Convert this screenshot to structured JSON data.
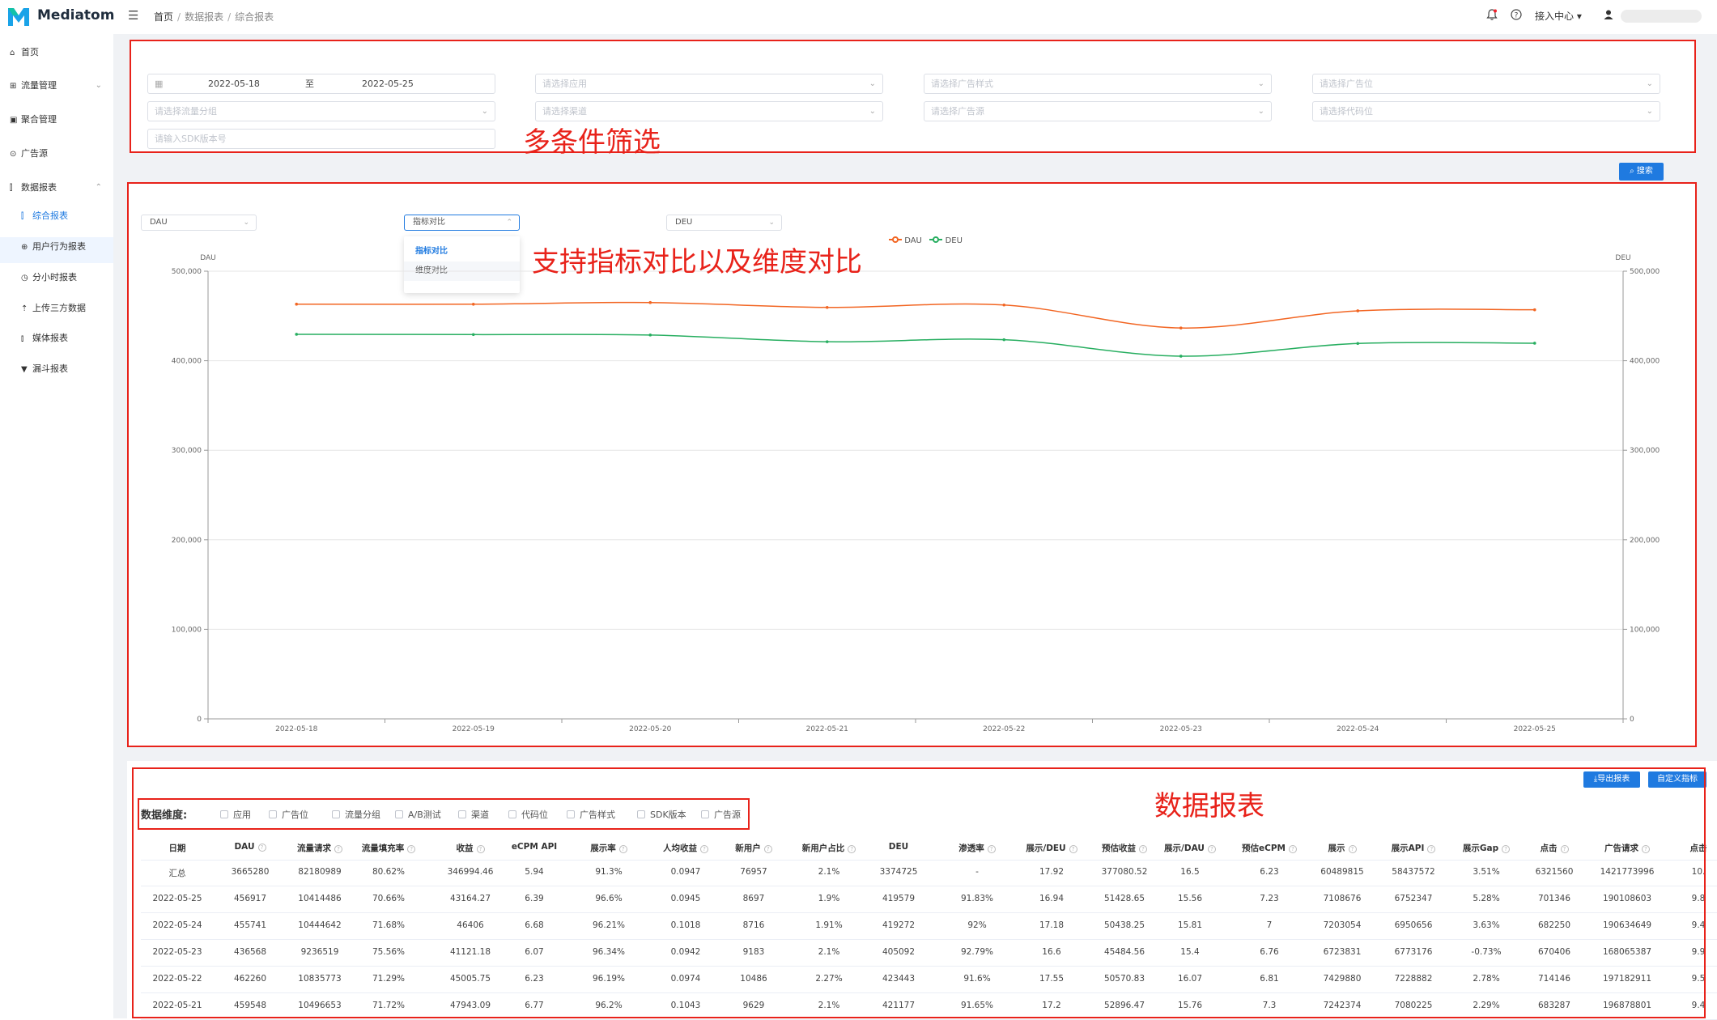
{
  "app": {
    "name": "Mediatom"
  },
  "breadcrumb": {
    "home": "首页",
    "reports": "数据报表",
    "current": "综合报表"
  },
  "topbar": {
    "access_center": "接入中心"
  },
  "sidebar": {
    "home": "首页",
    "traffic": "流量管理",
    "aggregate": "聚合管理",
    "ad_source": "广告源",
    "reports": "数据报表",
    "sub": {
      "overall": "综合报表",
      "user_behavior": "用户行为报表",
      "hourly": "分小时报表",
      "third_party": "上传三方数据",
      "media": "媒体报表",
      "funnel": "漏斗报表"
    }
  },
  "filters": {
    "date_start": "2022-05-18",
    "date_sep": "至",
    "date_end": "2022-05-25",
    "app_placeholder": "请选择应用",
    "ad_style_placeholder": "请选择广告样式",
    "ad_slot_placeholder": "请选择广告位",
    "traffic_group_placeholder": "请选择流量分组",
    "channel_placeholder": "请选择渠道",
    "ad_source_placeholder": "请选择广告源",
    "code_slot_placeholder": "请选择代码位",
    "sdk_placeholder": "请输入SDK版本号",
    "search_button": "搜索"
  },
  "annotations": {
    "filter": "多条件筛选",
    "chart": "支持指标对比以及维度对比",
    "table": "数据报表"
  },
  "chart_controls": {
    "left_metric": "DAU",
    "compare_mode": "指标对比",
    "right_metric": "DEU",
    "options": [
      "指标对比",
      "维度对比"
    ]
  },
  "colors": {
    "dau": "#f26522",
    "deu": "#27ae60",
    "accent": "#1f7ae0",
    "annotation": "#e8221a"
  },
  "chart_data": {
    "type": "line",
    "x": [
      "2022-05-18",
      "2022-05-19",
      "2022-05-20",
      "2022-05-21",
      "2022-05-22",
      "2022-05-23",
      "2022-05-24",
      "2022-05-25"
    ],
    "series": [
      {
        "name": "DAU",
        "axis": "left",
        "values": [
          463200,
          463100,
          465000,
          459548,
          462260,
          436568,
          455741,
          456917
        ]
      },
      {
        "name": "DEU",
        "axis": "right",
        "values": [
          429500,
          429200,
          428700,
          421177,
          423443,
          405092,
          419272,
          419579
        ]
      }
    ],
    "ylabel_left": "DAU",
    "ylabel_right": "DEU",
    "ylim": [
      0,
      500000
    ],
    "yticks": [
      "500,000",
      "400,000",
      "300,000",
      "200,000",
      "100,000",
      "0"
    ],
    "legend": "top-center",
    "grid": true
  },
  "table": {
    "export_button": "导出报表",
    "custom_metrics_button": "自定义指标",
    "dimension_label": "数据维度:",
    "dimensions": [
      "应用",
      "广告位",
      "流量分组",
      "A/B测试",
      "渠道",
      "代码位",
      "广告样式",
      "SDK版本",
      "广告源"
    ],
    "columns": [
      "日期",
      "DAU",
      "流量请求",
      "流量填充率",
      "收益",
      "eCPM API",
      "展示率",
      "人均收益",
      "新用户",
      "新用户占比",
      "DEU",
      "渗透率",
      "展示/DEU",
      "预估收益",
      "展示/DAU",
      "预估eCPM",
      "展示",
      "展示API",
      "展示Gap",
      "点击",
      "广告请求",
      "点击"
    ],
    "rows": [
      [
        "汇总",
        "3665280",
        "82180989",
        "80.62%",
        "346994.46",
        "5.94",
        "91.3%",
        "0.0947",
        "76957",
        "2.1%",
        "3374725",
        "-",
        "17.92",
        "377080.52",
        "16.5",
        "6.23",
        "60489815",
        "58437572",
        "3.51%",
        "6321560",
        "1421773996",
        "10."
      ],
      [
        "2022-05-25",
        "456917",
        "10414486",
        "70.66%",
        "43164.27",
        "6.39",
        "96.6%",
        "0.0945",
        "8697",
        "1.9%",
        "419579",
        "91.83%",
        "16.94",
        "51428.65",
        "15.56",
        "7.23",
        "7108676",
        "6752347",
        "5.28%",
        "701346",
        "190108603",
        "9.8"
      ],
      [
        "2022-05-24",
        "455741",
        "10444642",
        "71.68%",
        "46406",
        "6.68",
        "96.21%",
        "0.1018",
        "8716",
        "1.91%",
        "419272",
        "92%",
        "17.18",
        "50438.25",
        "15.81",
        "7",
        "7203054",
        "6950656",
        "3.63%",
        "682250",
        "190634649",
        "9.4"
      ],
      [
        "2022-05-23",
        "436568",
        "9236519",
        "75.56%",
        "41121.18",
        "6.07",
        "96.34%",
        "0.0942",
        "9183",
        "2.1%",
        "405092",
        "92.79%",
        "16.6",
        "45484.56",
        "15.4",
        "6.76",
        "6723831",
        "6773176",
        "-0.73%",
        "670406",
        "168065387",
        "9.9"
      ],
      [
        "2022-05-22",
        "462260",
        "10835773",
        "71.29%",
        "45005.75",
        "6.23",
        "96.19%",
        "0.0974",
        "10486",
        "2.27%",
        "423443",
        "91.6%",
        "17.55",
        "50570.83",
        "16.07",
        "6.81",
        "7429880",
        "7228882",
        "2.78%",
        "714146",
        "197182911",
        "9.5"
      ],
      [
        "2022-05-21",
        "459548",
        "10496653",
        "71.72%",
        "47943.09",
        "6.77",
        "96.2%",
        "0.1043",
        "9629",
        "2.1%",
        "421177",
        "91.65%",
        "17.2",
        "52896.47",
        "15.76",
        "7.3",
        "7242374",
        "7080225",
        "2.29%",
        "683287",
        "196878801",
        "9.4"
      ]
    ]
  }
}
